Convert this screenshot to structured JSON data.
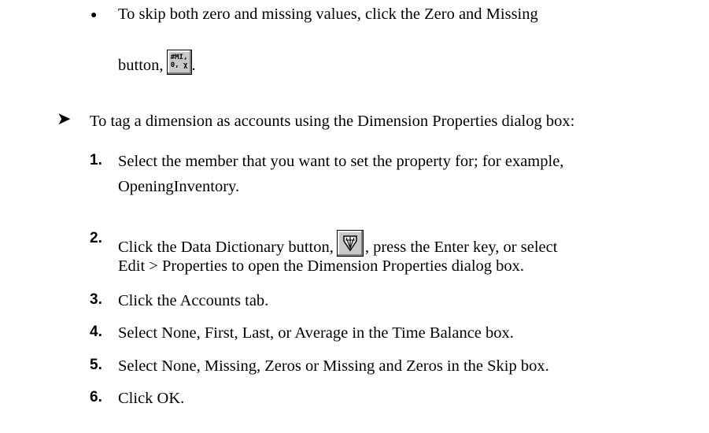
{
  "bullet_item": {
    "text_part1": "To skip both zero and missing values, click the Zero and Missing",
    "text_part2": "button,",
    "icon_line1": "#MI,",
    "icon_line2": "0, χ",
    "trailing": "."
  },
  "procedure": {
    "arrow": "➤",
    "heading": "To tag a dimension as accounts using the Dimension Properties dialog box:",
    "steps": [
      {
        "number": "1.",
        "line1": "Select the member that you want to set the property for; for example,",
        "line2": "OpeningInventory."
      },
      {
        "number": "2.",
        "line1_before_icon": "Click the Data Dictionary button,",
        "line1_after_icon": ", press the Enter key, or select",
        "line2": "Edit > Properties to open the Dimension Properties dialog box."
      },
      {
        "number": "3.",
        "line1": "Click the Accounts tab."
      },
      {
        "number": "4.",
        "line1": "Select None, First, Last, or Average in the Time Balance box."
      },
      {
        "number": "5.",
        "line1": "Select None, Missing, Zeros or Missing and Zeros in the Skip box."
      },
      {
        "number": "6.",
        "line1": "Click OK."
      }
    ]
  }
}
